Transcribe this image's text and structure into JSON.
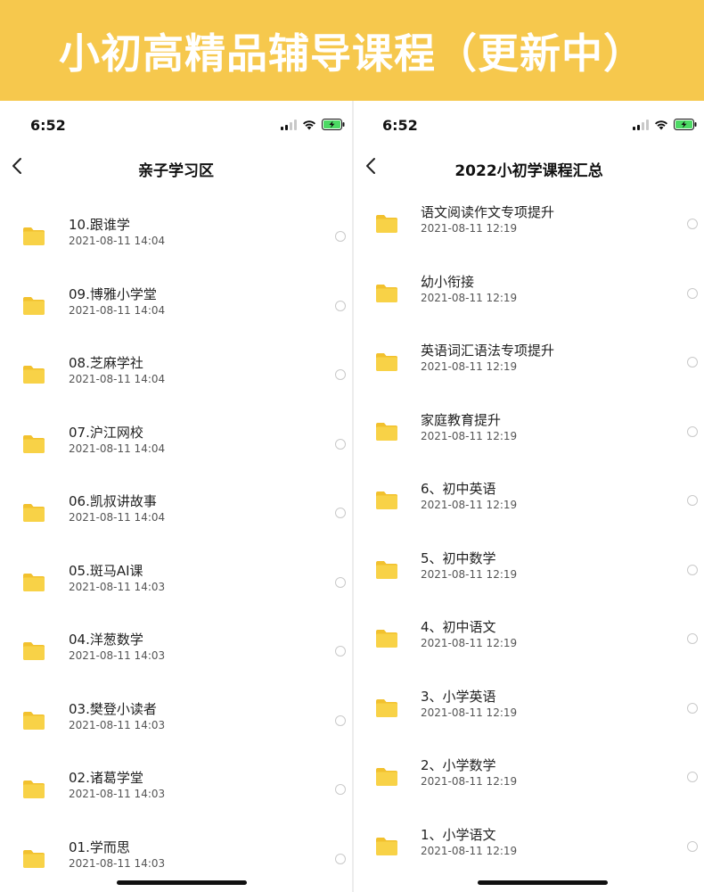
{
  "banner": {
    "title": "小初高精品辅导课程（更新中）"
  },
  "colors": {
    "banner": "#f6c84d",
    "folder": "#f8d247",
    "folder_tab": "#f2c12e",
    "battery": "#4cd964"
  },
  "left_panel": {
    "status_time": "6:52",
    "title": "亲子学习区",
    "back_icon": "chevron-left-icon",
    "files": [
      {
        "name": "10.跟谁学",
        "date": "2021-08-11 14:04"
      },
      {
        "name": "09.博雅小学堂",
        "date": "2021-08-11 14:04"
      },
      {
        "name": "08.芝麻学社",
        "date": "2021-08-11 14:04"
      },
      {
        "name": "07.沪江网校",
        "date": "2021-08-11 14:04"
      },
      {
        "name": "06.凯叔讲故事",
        "date": "2021-08-11 14:04"
      },
      {
        "name": "05.斑马AI课",
        "date": "2021-08-11 14:03"
      },
      {
        "name": "04.洋葱数学",
        "date": "2021-08-11 14:03"
      },
      {
        "name": "03.樊登小读者",
        "date": "2021-08-11 14:03"
      },
      {
        "name": "02.诸葛学堂",
        "date": "2021-08-11 14:03"
      },
      {
        "name": "01.学而思",
        "date": "2021-08-11 14:03"
      }
    ]
  },
  "right_panel": {
    "status_time": "6:52",
    "title": "2022小初学课程汇总",
    "back_icon": "chevron-left-icon",
    "files": [
      {
        "name": "语文阅读作文专项提升",
        "date": "2021-08-11 12:19"
      },
      {
        "name": "幼小衔接",
        "date": "2021-08-11 12:19"
      },
      {
        "name": "英语词汇语法专项提升",
        "date": "2021-08-11 12:19"
      },
      {
        "name": "家庭教育提升",
        "date": "2021-08-11 12:19"
      },
      {
        "name": "6、初中英语",
        "date": "2021-08-11 12:19"
      },
      {
        "name": "5、初中数学",
        "date": "2021-08-11 12:19"
      },
      {
        "name": "4、初中语文",
        "date": "2021-08-11 12:19"
      },
      {
        "name": "3、小学英语",
        "date": "2021-08-11 12:19"
      },
      {
        "name": "2、小学数学",
        "date": "2021-08-11 12:19"
      },
      {
        "name": "1、小学语文",
        "date": "2021-08-11 12:19"
      }
    ]
  }
}
